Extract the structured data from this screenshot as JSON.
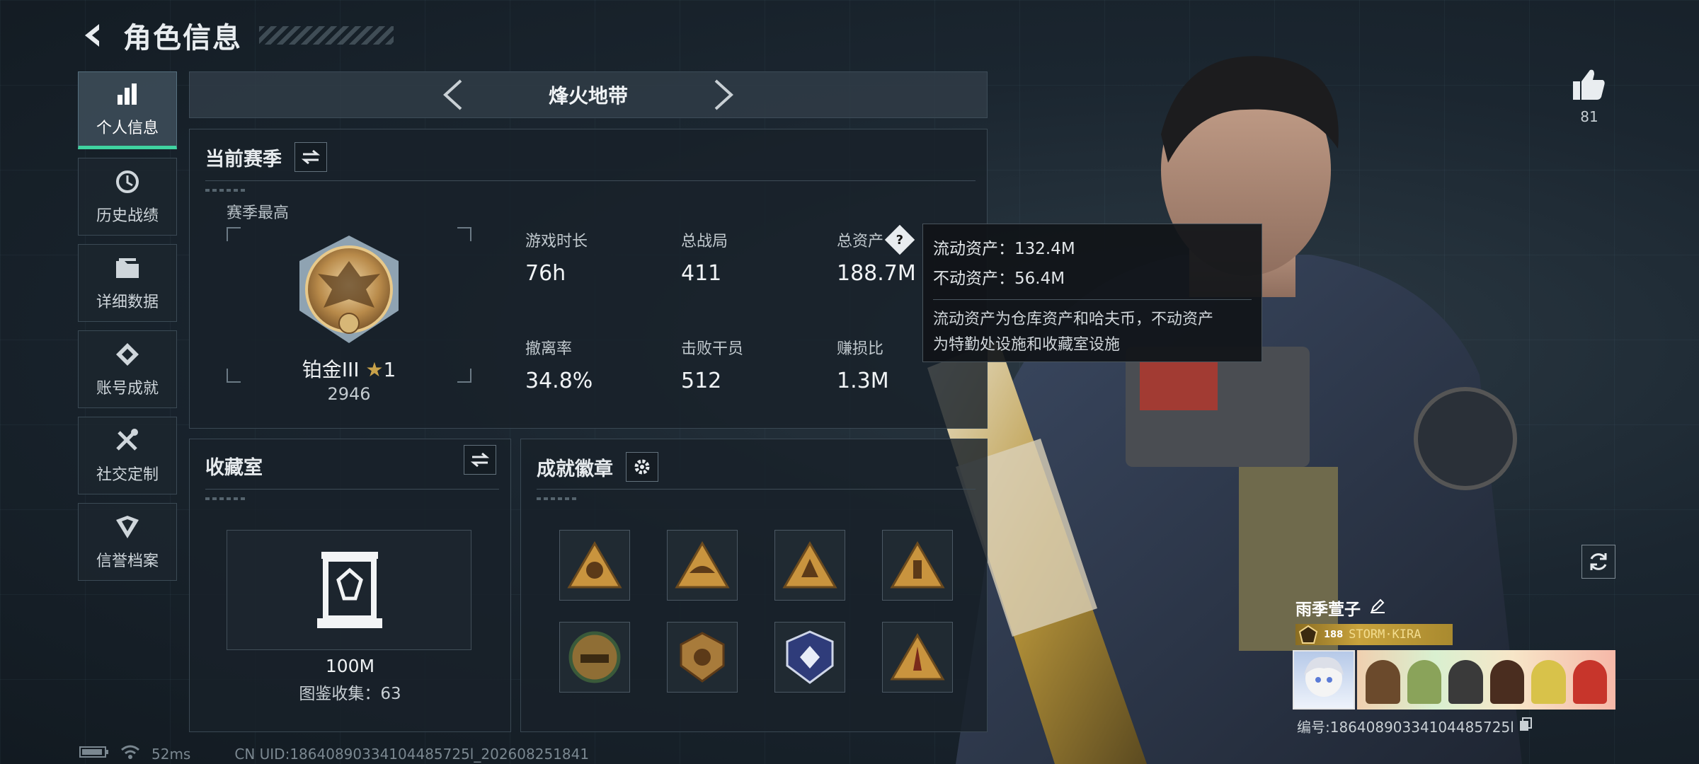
{
  "header": {
    "title": "角色信息"
  },
  "nav": {
    "items": [
      {
        "label": "个人信息",
        "icon": "bar-chart-icon",
        "active": true
      },
      {
        "label": "历史战绩",
        "icon": "history-clock-icon",
        "active": false
      },
      {
        "label": "详细数据",
        "icon": "folder-icon",
        "active": false
      },
      {
        "label": "账号成就",
        "icon": "achievement-icon",
        "active": false
      },
      {
        "label": "社交定制",
        "icon": "tools-icon",
        "active": false
      },
      {
        "label": "信誉档案",
        "icon": "reputation-icon",
        "active": false
      }
    ]
  },
  "mode": {
    "title": "烽火地带"
  },
  "season": {
    "title": "当前赛季",
    "best_label": "赛季最高",
    "rank_name": "铂金III",
    "rank_stars": "1",
    "rank_score": "2946",
    "stats": [
      {
        "label": "游戏时长",
        "value": "76h"
      },
      {
        "label": "总战局",
        "value": "411"
      },
      {
        "label": "总资产",
        "value": "188.7M",
        "help": "?"
      },
      {
        "label": "撤离率",
        "value": "34.8%"
      },
      {
        "label": "击败干员",
        "value": "512"
      },
      {
        "label": "赚损比",
        "value": "1.3M"
      }
    ]
  },
  "tooltip": {
    "liquid": "流动资产：132.4M",
    "fixed": "不动资产：56.4M",
    "desc_line1": "流动资产为仓库资产和哈夫币，不动资产",
    "desc_line2": "为特勤处设施和收藏室设施"
  },
  "collection": {
    "title": "收藏室",
    "amount": "100M",
    "count": "图鉴收集：63"
  },
  "achievements": {
    "title": "成就徽章",
    "badges": [
      "badge-fist-icon",
      "badge-hat-icon",
      "badge-triangle-icon",
      "badge-soldier-icon",
      "badge-tank-icon",
      "badge-shield-icon",
      "badge-diamond-icon",
      "badge-rocket-icon"
    ]
  },
  "likes": {
    "count": "81"
  },
  "player": {
    "name": "雨季萱子",
    "level": "188",
    "tag": "STORM·KIRA",
    "id_text": "编号:18640890334104485725l"
  },
  "status": {
    "ping": "52ms",
    "uid": "CN UID:18640890334104485725l_202608251841"
  },
  "colors": {
    "accent_green": "#3fd3a0",
    "gold": "#c8a23c"
  }
}
